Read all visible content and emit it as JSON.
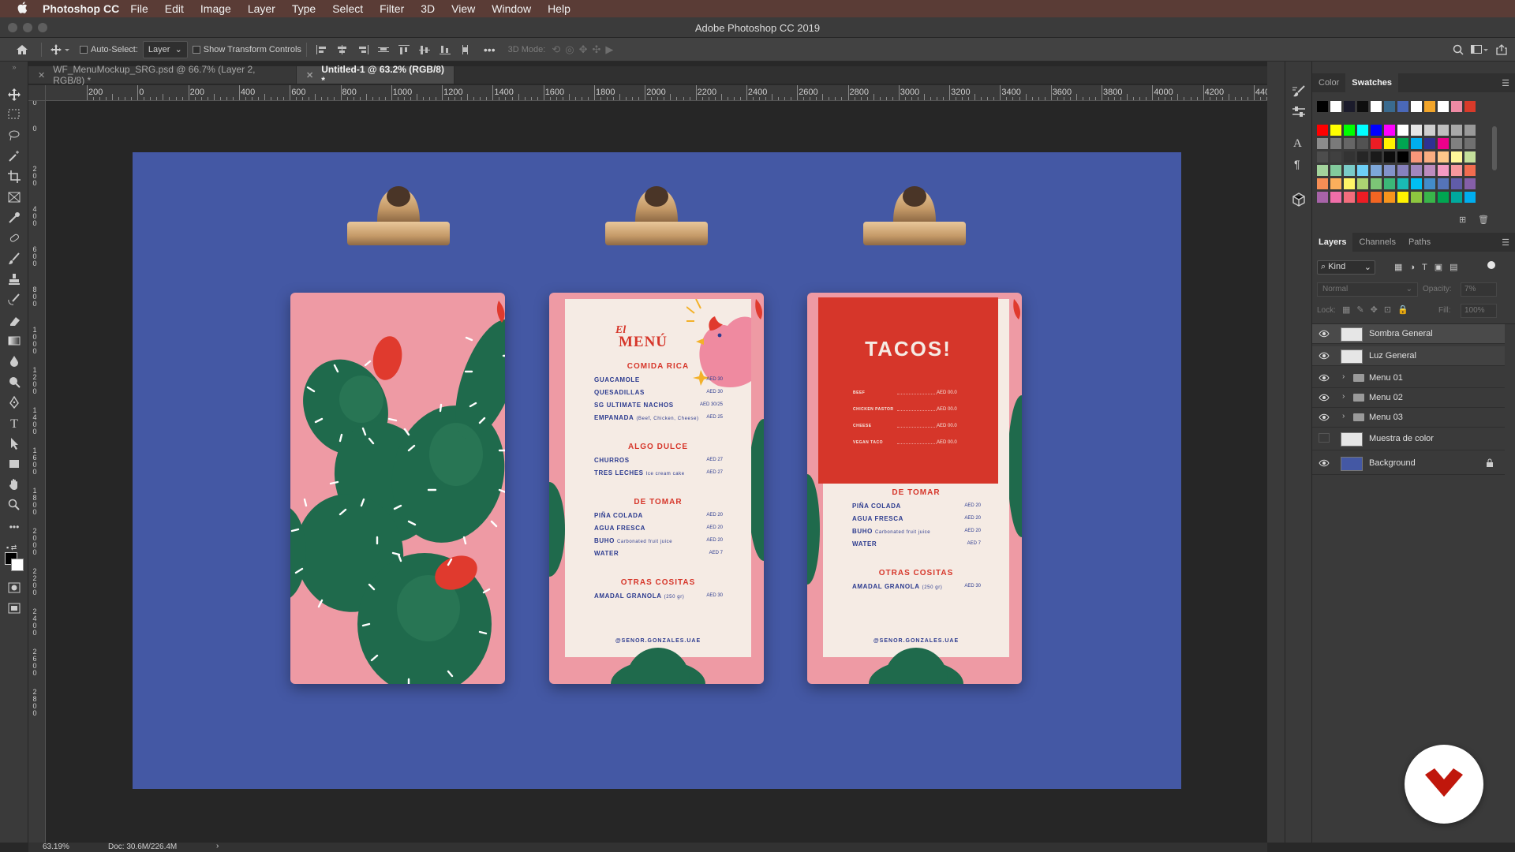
{
  "menubar": {
    "apple": "",
    "app_name": "Photoshop CC",
    "items": [
      "File",
      "Edit",
      "Image",
      "Layer",
      "Type",
      "Select",
      "Filter",
      "3D",
      "View",
      "Window",
      "Help"
    ]
  },
  "window": {
    "title": "Adobe Photoshop CC 2019"
  },
  "options": {
    "auto_select_label": "Auto-Select:",
    "auto_select_value": "Layer",
    "show_transform_label": "Show Transform Controls",
    "mode_3d_label": "3D Mode:"
  },
  "doc_tabs": [
    {
      "label": "WF_MenuMockup_SRG.psd @ 66.7% (Layer 2, RGB/8) *",
      "active": false
    },
    {
      "label": "Untitled-1 @ 63.2% (RGB/8) *",
      "active": true
    }
  ],
  "ruler_top_labels": [
    "200",
    "0",
    "200",
    "400",
    "600",
    "800",
    "1000",
    "1200",
    "1400",
    "1600",
    "1800",
    "2000",
    "2200",
    "2400",
    "2600",
    "2800",
    "3000",
    "3200",
    "3400",
    "3600",
    "3800",
    "4000",
    "4200",
    "4400"
  ],
  "ruler_left_labels": [
    "200",
    "0",
    "200",
    "400",
    "600",
    "800",
    "1000",
    "1200",
    "1400",
    "1600",
    "1800",
    "2000",
    "2200",
    "2400",
    "2600",
    "2800"
  ],
  "tools": [
    "move-icon",
    "marquee-icon",
    "lasso-icon",
    "magic-wand-icon",
    "crop-icon",
    "frame-icon",
    "eyedropper-icon",
    "healing-icon",
    "brush-icon",
    "stamp-icon",
    "history-brush-icon",
    "eraser-icon",
    "gradient-icon",
    "blur-icon",
    "dodge-icon",
    "pen-icon",
    "type-icon",
    "path-select-icon",
    "rectangle-icon",
    "hand-icon",
    "zoom-icon",
    "more-icon"
  ],
  "menu2": {
    "title_script": "El",
    "title": "MENÚ",
    "sections": [
      {
        "heading": "COMIDA RICA",
        "items": [
          {
            "name": "GUACAMOLE",
            "sub": "",
            "price": "AED 30"
          },
          {
            "name": "QUESADILLAS",
            "sub": "",
            "price": "AED 30"
          },
          {
            "name": "SG ULTIMATE NACHOS",
            "sub": "",
            "price": "AED 30/25"
          },
          {
            "name": "EMPANADA",
            "sub": "(Beef, Chicken, Cheese)",
            "price": "AED 25"
          }
        ]
      },
      {
        "heading": "ALGO DULCE",
        "items": [
          {
            "name": "CHURROS",
            "sub": "",
            "price": "AED 27"
          },
          {
            "name": "TRES LECHES",
            "sub": "Ice cream cake",
            "price": "AED 27"
          }
        ]
      },
      {
        "heading": "DE TOMAR",
        "items": [
          {
            "name": "PIÑA COLADA",
            "sub": "",
            "price": "AED 20"
          },
          {
            "name": "AGUA FRESCA",
            "sub": "",
            "price": "AED 20"
          },
          {
            "name": "BUHO",
            "sub": "Carbonated fruit juice",
            "price": "AED 20"
          },
          {
            "name": "WATER",
            "sub": "",
            "price": "AED 7"
          }
        ]
      },
      {
        "heading": "OTRAS COSITAS",
        "items": [
          {
            "name": "AMADAL GRANOLA",
            "sub": "(250 gr)",
            "price": "AED 30"
          }
        ]
      }
    ],
    "handle": "@SENOR.GONZALES.UAE"
  },
  "menu3": {
    "title": "TACOS!",
    "taco_items": [
      {
        "name": "BEEF",
        "price": "AED 00.0"
      },
      {
        "name": "CHICKEN PASTOR",
        "price": "AED 00.0"
      },
      {
        "name": "CHEESE",
        "price": "AED 00.0"
      },
      {
        "name": "VEGAN TACO",
        "price": "AED 00.0"
      }
    ],
    "sections": [
      {
        "heading": "DE TOMAR",
        "items": [
          {
            "name": "PIÑA COLADA",
            "sub": "",
            "price": "AED 20"
          },
          {
            "name": "AGUA FRESCA",
            "sub": "",
            "price": "AED 20"
          },
          {
            "name": "BUHO",
            "sub": "Carbonated fruit juice",
            "price": "AED 20"
          },
          {
            "name": "WATER",
            "sub": "",
            "price": "AED 7"
          }
        ]
      },
      {
        "heading": "OTRAS COSITAS",
        "items": [
          {
            "name": "AMADAL GRANOLA",
            "sub": "(250 gr)",
            "price": "AED 30"
          }
        ]
      }
    ],
    "handle": "@SENOR.GONZALES.UAE"
  },
  "right_panel": {
    "color_tabs": [
      "Color",
      "Swatches"
    ],
    "layer_tabs": [
      "Layers",
      "Channels",
      "Paths"
    ],
    "kind_label": "Kind",
    "blend_mode": "Normal",
    "opacity_label": "Opacity:",
    "opacity_value": "7%",
    "lock_label": "Lock:",
    "fill_label": "Fill:",
    "fill_value": "100%",
    "layers": [
      {
        "name": "Sombra General",
        "visible": true,
        "type": "pixel"
      },
      {
        "name": "Luz General",
        "visible": true,
        "type": "pixel"
      },
      {
        "name": "Menu 01",
        "visible": true,
        "type": "group"
      },
      {
        "name": "Menu 02",
        "visible": true,
        "type": "group"
      },
      {
        "name": "Menu 03",
        "visible": true,
        "type": "group"
      },
      {
        "name": "Muestra de color",
        "visible": false,
        "type": "pixel"
      },
      {
        "name": "Background",
        "visible": true,
        "type": "background"
      }
    ]
  },
  "status": {
    "zoom": "63.19%",
    "doc": "Doc: 30.6M/226.4M"
  },
  "colors": {
    "canvas_bg": "#4458a4",
    "board_pink": "#ee9aa4",
    "cactus_green": "#1f6a4c",
    "accent_red": "#d6362a",
    "menu_blue": "#2c3b8f"
  }
}
